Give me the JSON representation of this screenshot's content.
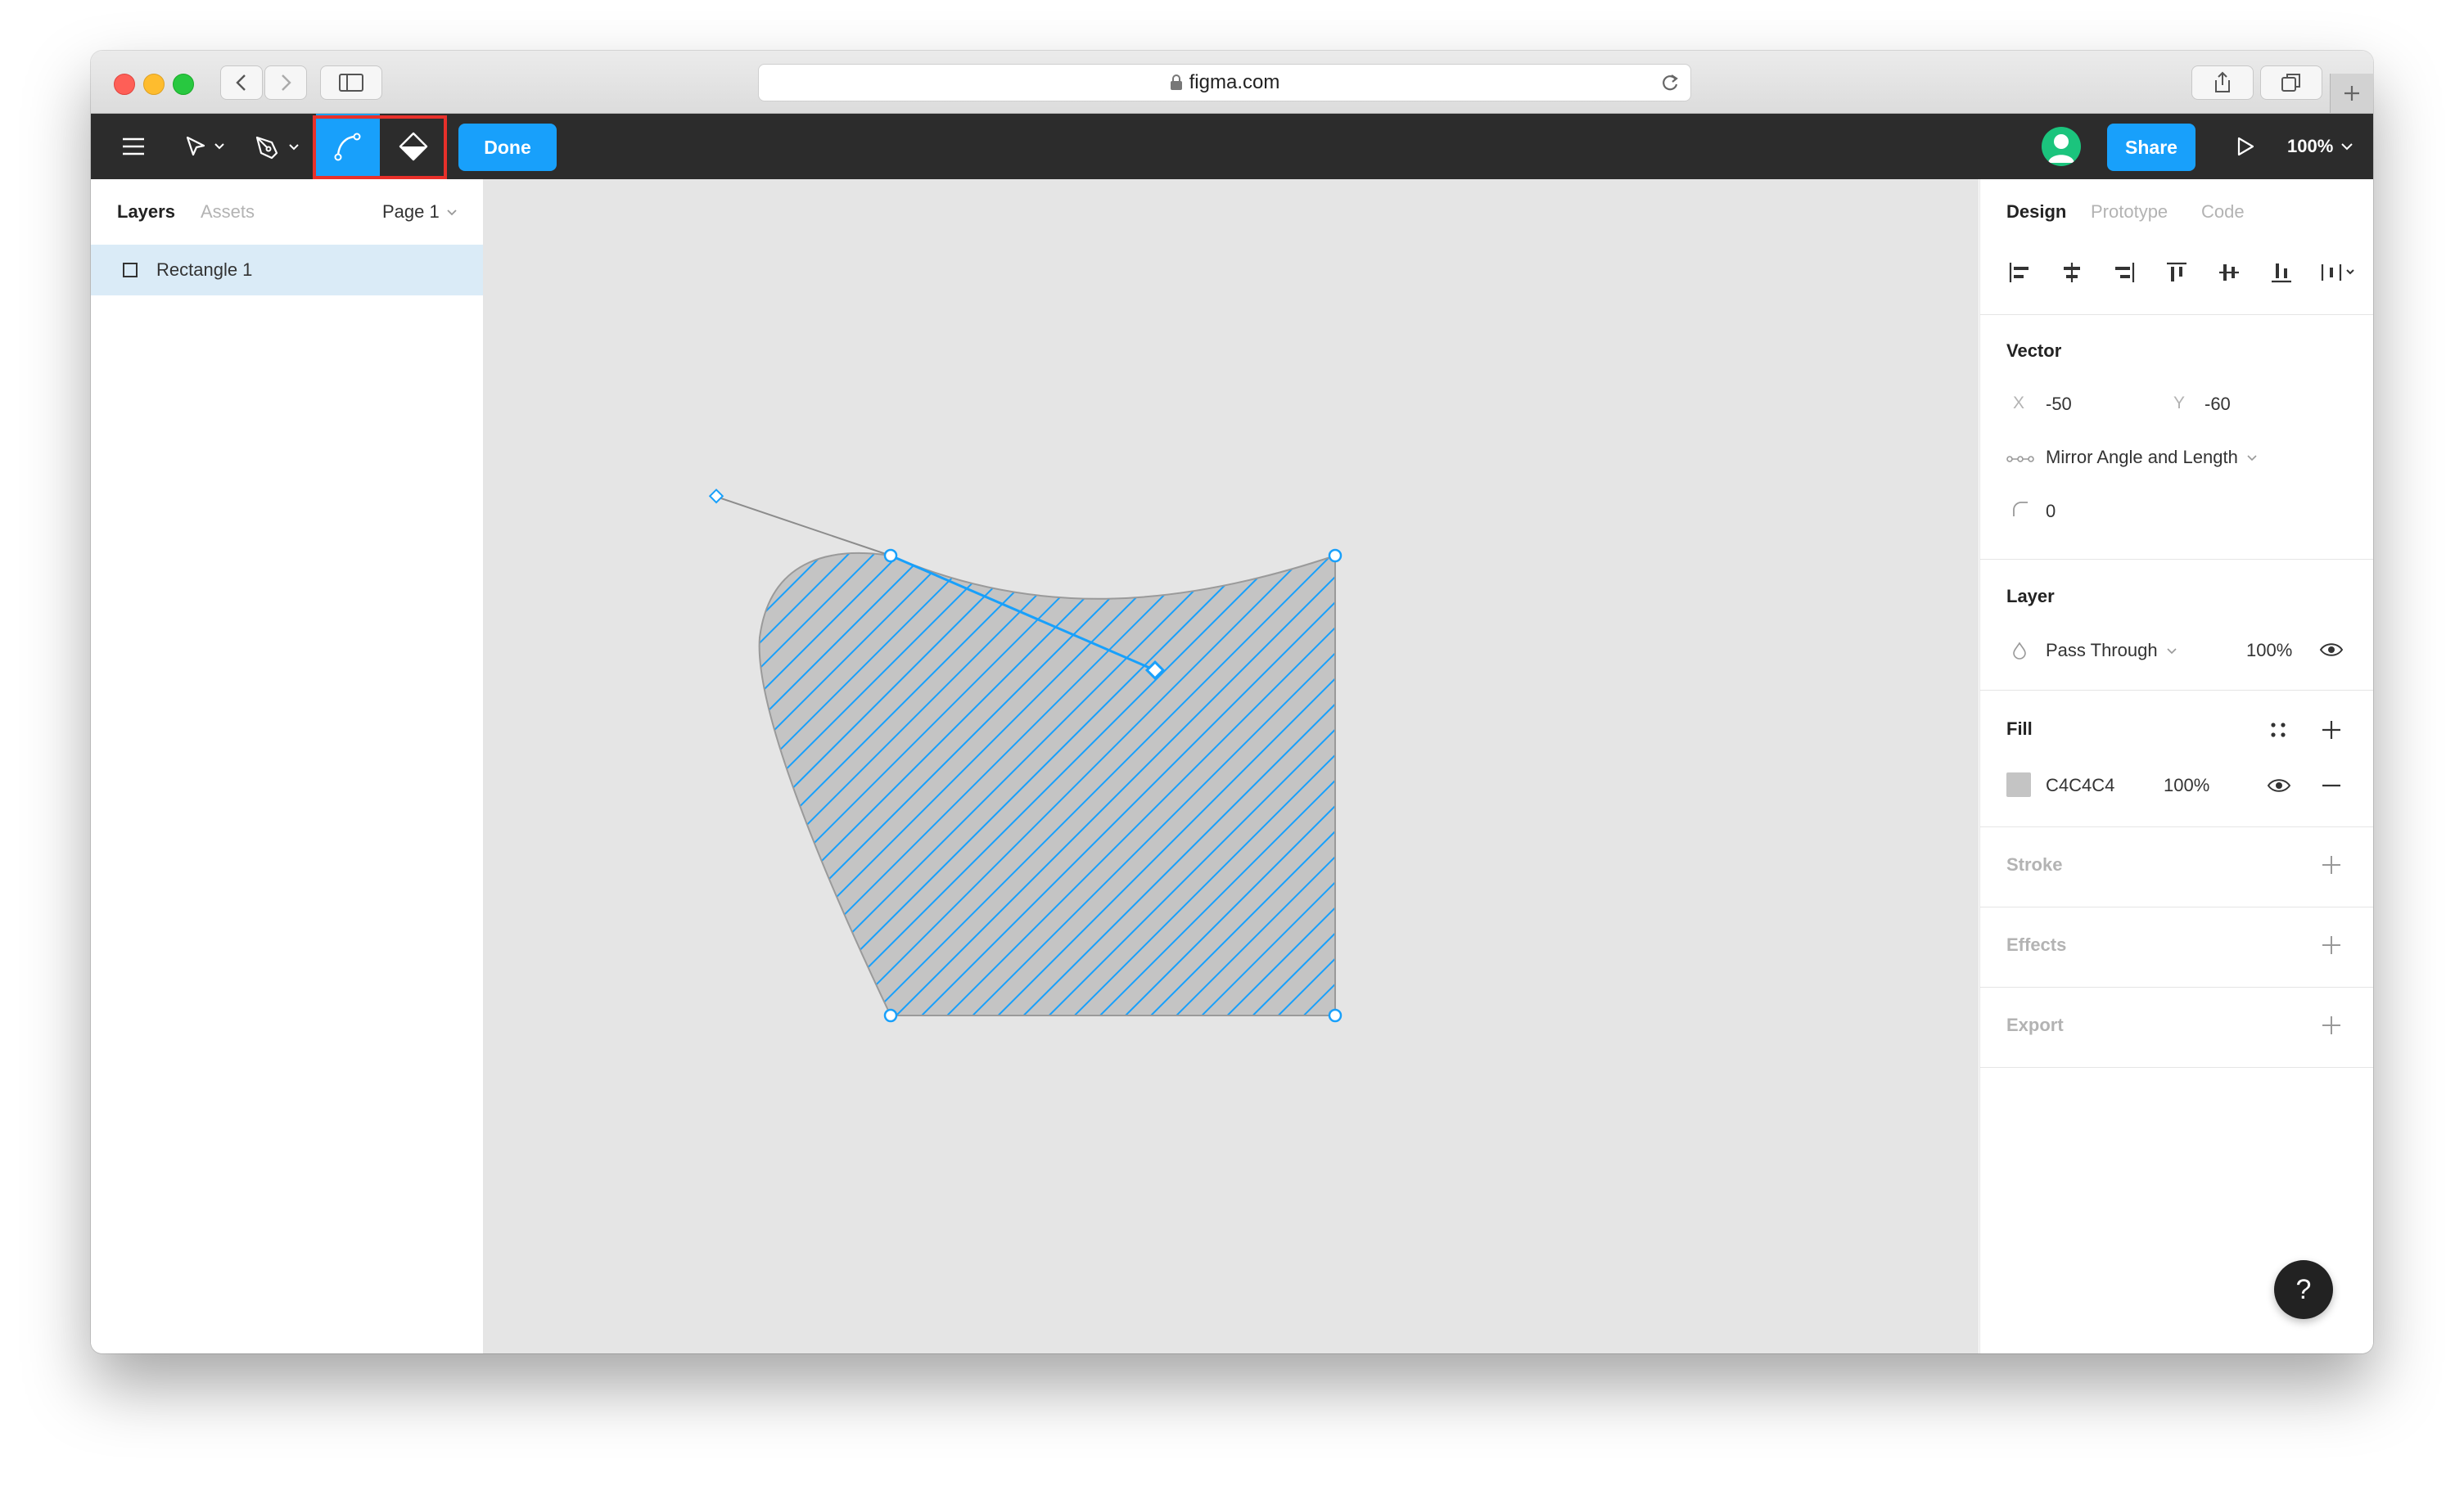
{
  "browser": {
    "url": "figma.com"
  },
  "toolbar": {
    "done_label": "Done",
    "share_label": "Share",
    "zoom_label": "100%"
  },
  "left_panel": {
    "tabs": [
      "Layers",
      "Assets"
    ],
    "page_label": "Page 1",
    "layers": [
      {
        "name": "Rectangle 1"
      }
    ]
  },
  "right_panel": {
    "tabs": [
      "Design",
      "Prototype",
      "Code"
    ],
    "vector": {
      "title": "Vector",
      "x_label": "X",
      "x_value": "-50",
      "y_label": "Y",
      "y_value": "-60",
      "mirroring": "Mirror Angle and Length",
      "corner_radius": "0"
    },
    "layer": {
      "title": "Layer",
      "blend_mode": "Pass Through",
      "opacity": "100%"
    },
    "fill": {
      "title": "Fill",
      "color_hex": "C4C4C4",
      "opacity": "100%"
    },
    "stroke_title": "Stroke",
    "effects_title": "Effects",
    "export_title": "Export"
  },
  "help_label": "?",
  "colors": {
    "accent": "#18a0fb",
    "toolbar_bg": "#2c2c2c",
    "canvas_bg": "#e5e5e5",
    "highlight": "#e8302a",
    "fill": "#c4c4c4"
  }
}
